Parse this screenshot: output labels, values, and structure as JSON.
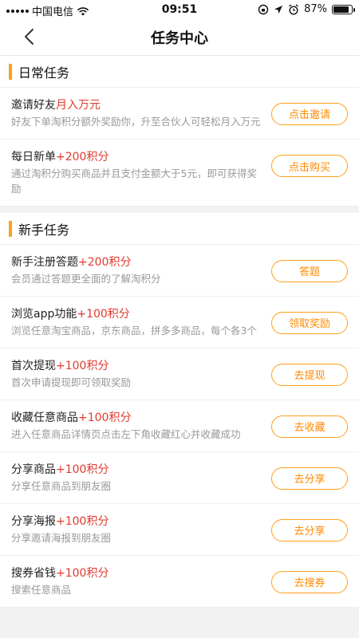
{
  "status_bar": {
    "carrier": "中国电信",
    "time": "09:51",
    "battery_percent": "87%",
    "battery_level": 0.87
  },
  "nav": {
    "title": "任务中心",
    "back_icon": "chevron-left-icon"
  },
  "sections": [
    {
      "title": "日常任务",
      "tasks": [
        {
          "title": "邀请好友",
          "points": "月入万元",
          "desc": "好友下单淘积分额外奖励你，升至合伙人可轻松月入万元",
          "button": "点击邀请"
        },
        {
          "title": "每日新单",
          "points": "+200积分",
          "desc": "通过淘积分购买商品并且支付金额大于5元，即可获得奖励",
          "button": "点击购买"
        }
      ]
    },
    {
      "title": "新手任务",
      "tasks": [
        {
          "title": "新手注册答题",
          "points": "+200积分",
          "desc": "会员通过答题更全面的了解淘积分",
          "button": "答题"
        },
        {
          "title": "浏览app功能",
          "points": "+100积分",
          "desc": "浏览任意淘宝商品，京东商品，拼多多商品，每个各3个",
          "button": "领取奖励"
        },
        {
          "title": "首次提现",
          "points": "+100积分",
          "desc": "首次申请提现即可领取奖励",
          "button": "去提现"
        },
        {
          "title": "收藏任意商品",
          "points": "+100积分",
          "desc": "进入任意商品详情页点击左下角收藏红心并收藏成功",
          "button": "去收藏"
        },
        {
          "title": "分享商品",
          "points": "+100积分",
          "desc": "分享任意商品到朋友圈",
          "button": "去分享"
        },
        {
          "title": "分享海报",
          "points": "+100积分",
          "desc": "分享邀请海报到朋友圈",
          "button": "去分享"
        },
        {
          "title": "搜券省钱",
          "points": "+100积分",
          "desc": "搜索任意商品",
          "button": "去搜券"
        }
      ]
    }
  ],
  "colors": {
    "accent": "#ff9f1a",
    "points": "#e0392d",
    "desc": "#999999"
  }
}
